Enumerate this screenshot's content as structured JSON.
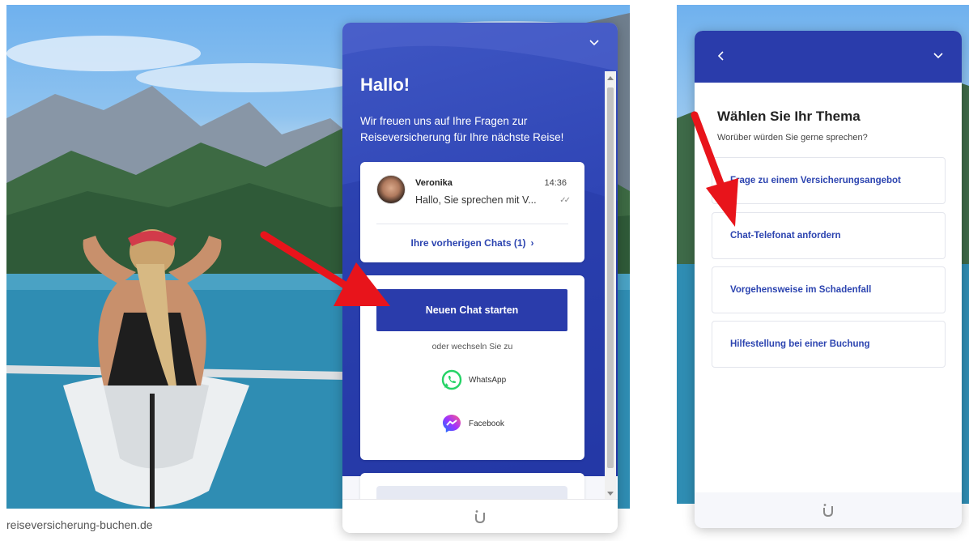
{
  "footer_site": {
    "url": "reiseversicherung-buchen.de"
  },
  "chat_home": {
    "title": "Hallo!",
    "subtitle": "Wir freuen uns auf Ihre Fragen zur Reiseversicherung für Ihre nächste Reise!",
    "conversation": {
      "agent_name": "Veronika",
      "time": "14:36",
      "preview": "Hallo, Sie sprechen mit V...",
      "previous_chats_label": "Ihre vorherigen Chats (1)"
    },
    "start_button_label": "Neuen Chat starten",
    "switch_label": "oder wechseln Sie zu",
    "channels": [
      {
        "label": "WhatsApp",
        "icon": "whatsapp-icon",
        "color": "#25d366"
      },
      {
        "label": "Facebook",
        "icon": "messenger-icon",
        "color": "#7b4dff"
      }
    ]
  },
  "chat_topics": {
    "title": "Wählen Sie Ihr Thema",
    "subtitle": "Worüber würden Sie gerne sprechen?",
    "topics": [
      {
        "label": "Frage zu einem Versicherungsangebot"
      },
      {
        "label": "Chat-Telefonat anfordern"
      },
      {
        "label": "Vorgehensweise im Schadenfall"
      },
      {
        "label": "Hilfestellung bei einer Buchung"
      }
    ]
  },
  "colors": {
    "brand_blue": "#2a3cab",
    "link_blue": "#2c44b0",
    "annotation_red": "#e8141b"
  }
}
